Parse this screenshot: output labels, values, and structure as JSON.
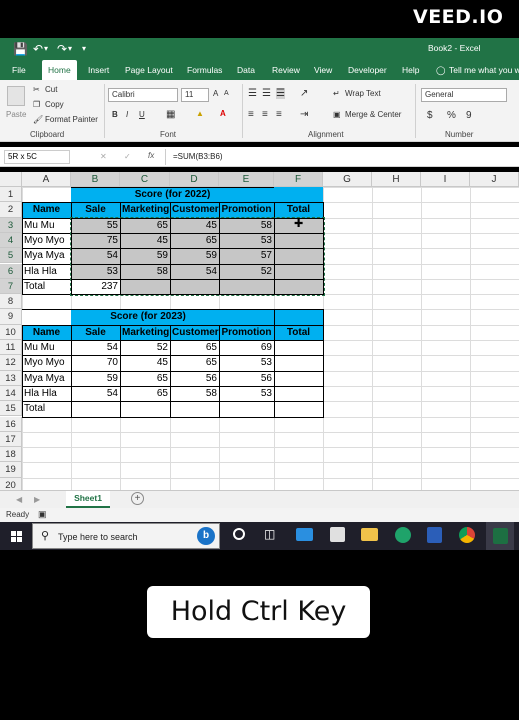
{
  "watermark": "VEED.IO",
  "titlebar": {
    "title": "Book2 - Excel"
  },
  "tabs": [
    "File",
    "Home",
    "Insert",
    "Page Layout",
    "Formulas",
    "Data",
    "Review",
    "View",
    "Developer",
    "Help"
  ],
  "tell_me": "Tell me what you wa",
  "ribbon": {
    "paste": "Paste",
    "cut": "Cut",
    "copy": "Copy",
    "format_painter": "Format Painter",
    "clipboard": "Clipboard",
    "font_name": "Calibri",
    "font_size": "11",
    "bold": "B",
    "italic": "I",
    "underline": "U",
    "font_grow": "A",
    "font_shrink": "A",
    "font_color": "A",
    "font_group": "Font",
    "wrap_text": "Wrap Text",
    "merge_center": "Merge & Center",
    "alignment": "Alignment",
    "number_format": "General",
    "currency": "$",
    "percent": "%",
    "comma": "9",
    "number": "Number"
  },
  "formula_bar": {
    "name_box": "5R x 5C",
    "fx": "fx",
    "formula": "=SUM(B3:B6)"
  },
  "columns": [
    "A",
    "B",
    "C",
    "D",
    "E",
    "F",
    "G",
    "H",
    "I",
    "J"
  ],
  "rows": [
    "1",
    "2",
    "3",
    "4",
    "5",
    "6",
    "7",
    "8",
    "9",
    "10",
    "11",
    "12",
    "13",
    "14",
    "15",
    "16",
    "17",
    "18",
    "19",
    "20"
  ],
  "table2022": {
    "title": "Score (for 2022)",
    "headers": [
      "Name",
      "Sale",
      "Marketing",
      "Customer",
      "Promotion",
      "Total"
    ],
    "rows": [
      [
        "Mu Mu",
        "55",
        "65",
        "45",
        "58"
      ],
      [
        "Myo Myo",
        "75",
        "45",
        "65",
        "53"
      ],
      [
        "Mya Mya",
        "54",
        "59",
        "59",
        "57"
      ],
      [
        "Hla Hla",
        "53",
        "58",
        "54",
        "52"
      ]
    ],
    "total_label": "Total",
    "total_sale": "237"
  },
  "table2023": {
    "title": "Score (for 2023)",
    "headers": [
      "Name",
      "Sale",
      "Marketing",
      "Customer",
      "Promotion",
      "Total"
    ],
    "rows": [
      [
        "Mu Mu",
        "54",
        "52",
        "65",
        "69"
      ],
      [
        "Myo Myo",
        "70",
        "45",
        "65",
        "53"
      ],
      [
        "Mya Mya",
        "59",
        "65",
        "56",
        "56"
      ],
      [
        "Hla Hla",
        "54",
        "65",
        "58",
        "53"
      ]
    ],
    "total_label": "Total"
  },
  "sheet_tab": "Sheet1",
  "add_sheet": "+",
  "status": "Ready",
  "taskbar": {
    "search_placeholder": "Type here to search"
  },
  "caption": "Hold Ctrl Key",
  "colors": {
    "excel_green": "#217346",
    "header_cyan": "#00b0f0",
    "selection_gray": "#c6c6c6"
  }
}
